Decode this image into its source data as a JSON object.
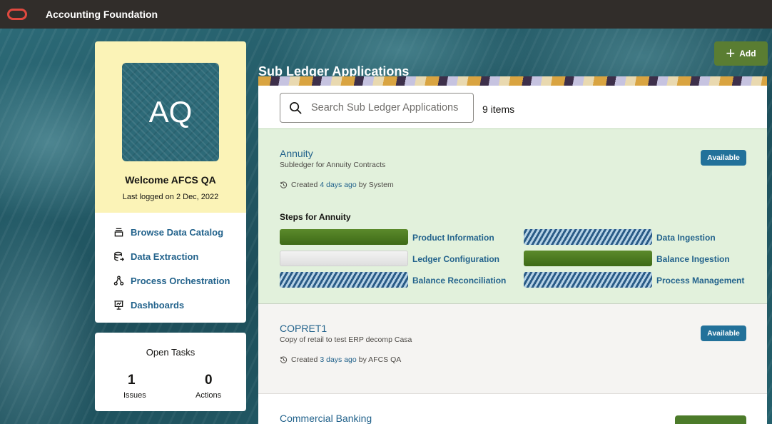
{
  "app": {
    "title": "Accounting Foundation"
  },
  "colors": {
    "topbar": "#312d2a",
    "accent": "#23638c",
    "available_badge": "#22719a",
    "done": "#4c7b2a",
    "logo": "#e0493f"
  },
  "profile": {
    "initials": "AQ",
    "welcome": "Welcome AFCS QA",
    "last_logged": "Last logged on 2 Dec, 2022"
  },
  "nav": {
    "items": [
      {
        "label": "Browse Data Catalog",
        "icon": "catalog-icon"
      },
      {
        "label": "Data Extraction",
        "icon": "database-export-icon"
      },
      {
        "label": "Process Orchestration",
        "icon": "orchestration-icon"
      },
      {
        "label": "Dashboards",
        "icon": "dashboard-icon"
      }
    ]
  },
  "tasks": {
    "title": "Open Tasks",
    "issues_count": "1",
    "issues_label": "Issues",
    "actions_count": "0",
    "actions_label": "Actions"
  },
  "main": {
    "title": "Sub Ledger Applications",
    "add_label": "Add",
    "search_placeholder": "Search Sub Ledger Applications",
    "items_count": "9 items"
  },
  "apps": [
    {
      "name": "Annuity",
      "description": "Subledger for Annuity Contracts",
      "created_prefix": "Created",
      "created_when": "4 days ago",
      "created_by": "by System",
      "status": "Available",
      "steps_title": "Steps for Annuity",
      "steps": [
        {
          "label": "Product Information",
          "state": "done"
        },
        {
          "label": "Data Ingestion",
          "state": "in-progress"
        },
        {
          "label": "Ledger Configuration",
          "state": "not-started"
        },
        {
          "label": "Balance Ingestion",
          "state": "done"
        },
        {
          "label": "Balance Reconciliation",
          "state": "in-progress"
        },
        {
          "label": "Process Management",
          "state": "in-progress"
        }
      ]
    },
    {
      "name": "COPRET1",
      "description": "Copy of retail to test ERP decomp Casa",
      "created_prefix": "Created",
      "created_when": "3 days ago",
      "created_by": "by AFCS QA",
      "status": "Available"
    },
    {
      "name": "Commercial Banking"
    }
  ]
}
